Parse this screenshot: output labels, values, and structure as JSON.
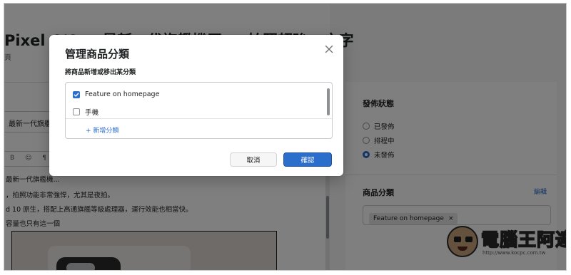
{
  "page": {
    "title": "Pixel 4/4 … 最新一代旗艦機王 — 拍照超強 · 文字",
    "subtitle": "頁",
    "product_title_value": "最新一代旗艦機王",
    "toolbar_glyphs": "B ☺ ¶",
    "editor_lines": [
      "最新一代旗艦機…",
      "，拍照功能非常強悍，尤其是夜拍。",
      "d 10 原生，搭配上高通旗艦等級處理器，運行效能也相當快。",
      "容量也只有這一個"
    ]
  },
  "publish_status": {
    "heading": "發佈狀態",
    "options": [
      {
        "label": "已發佈",
        "selected": false
      },
      {
        "label": "排程中",
        "selected": false
      },
      {
        "label": "未發佈",
        "selected": true
      }
    ]
  },
  "product_category": {
    "heading": "商品分類",
    "edit_label": "編輯",
    "tags": [
      {
        "label": "Feature on homepage",
        "remove_glyph": "×"
      }
    ]
  },
  "watermark": {
    "text": "電腦王阿達",
    "url": "http://www.kocpc.com.tw"
  },
  "modal": {
    "title": "管理商品分類",
    "description": "將商品新增或移出某分類",
    "items": [
      {
        "label": "Feature on homepage",
        "checked": true
      },
      {
        "label": "手機",
        "checked": false
      }
    ],
    "add_label": "+ 新增分類",
    "cancel_label": "取消",
    "confirm_label": "確認"
  },
  "colors": {
    "accent": "#2c6ecb",
    "overlay": "rgba(0,0,0,0.5)"
  }
}
